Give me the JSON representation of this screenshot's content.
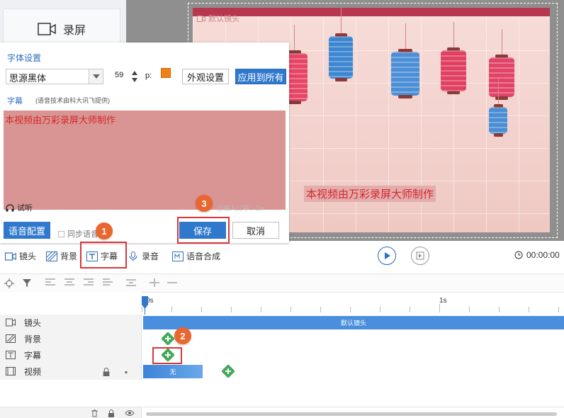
{
  "left_panel": {
    "record_label": "录屏"
  },
  "preview": {
    "camera_label": "默认镜头",
    "subtitle_text": "本视频由万彩录屏大师制作"
  },
  "subtitle_panel": {
    "font_settings_title": "字体设置",
    "font_name": "思源黑体",
    "font_size": "59",
    "p_label": "p:",
    "color": "#f07f14",
    "appearance_button": "外观设置",
    "apply_all_button": "应用到所有",
    "subtitle_section_title": "字幕",
    "voice_hint": "(语音技术由科大讯飞提供)",
    "text_content": "本视频由万彩录屏大师制作",
    "listen_label": "试听",
    "char_count": "已输入12字：1w",
    "voice_config_button": "语音配置",
    "sync_voice_label": "同步语音",
    "save_button": "保存",
    "cancel_button": "取消"
  },
  "toolbar": {
    "items": [
      "镜头",
      "背景",
      "字幕",
      "录音",
      "语音合成"
    ],
    "time": "00:00:00"
  },
  "timeline": {
    "ruler_labels": [
      "0s",
      "1s"
    ],
    "rows": [
      {
        "label": "镜头",
        "bar": "默认镜头"
      },
      {
        "label": "背景"
      },
      {
        "label": "字幕"
      },
      {
        "label": "视频",
        "bar": "无"
      }
    ]
  },
  "annotations": [
    "1",
    "2",
    "3"
  ]
}
